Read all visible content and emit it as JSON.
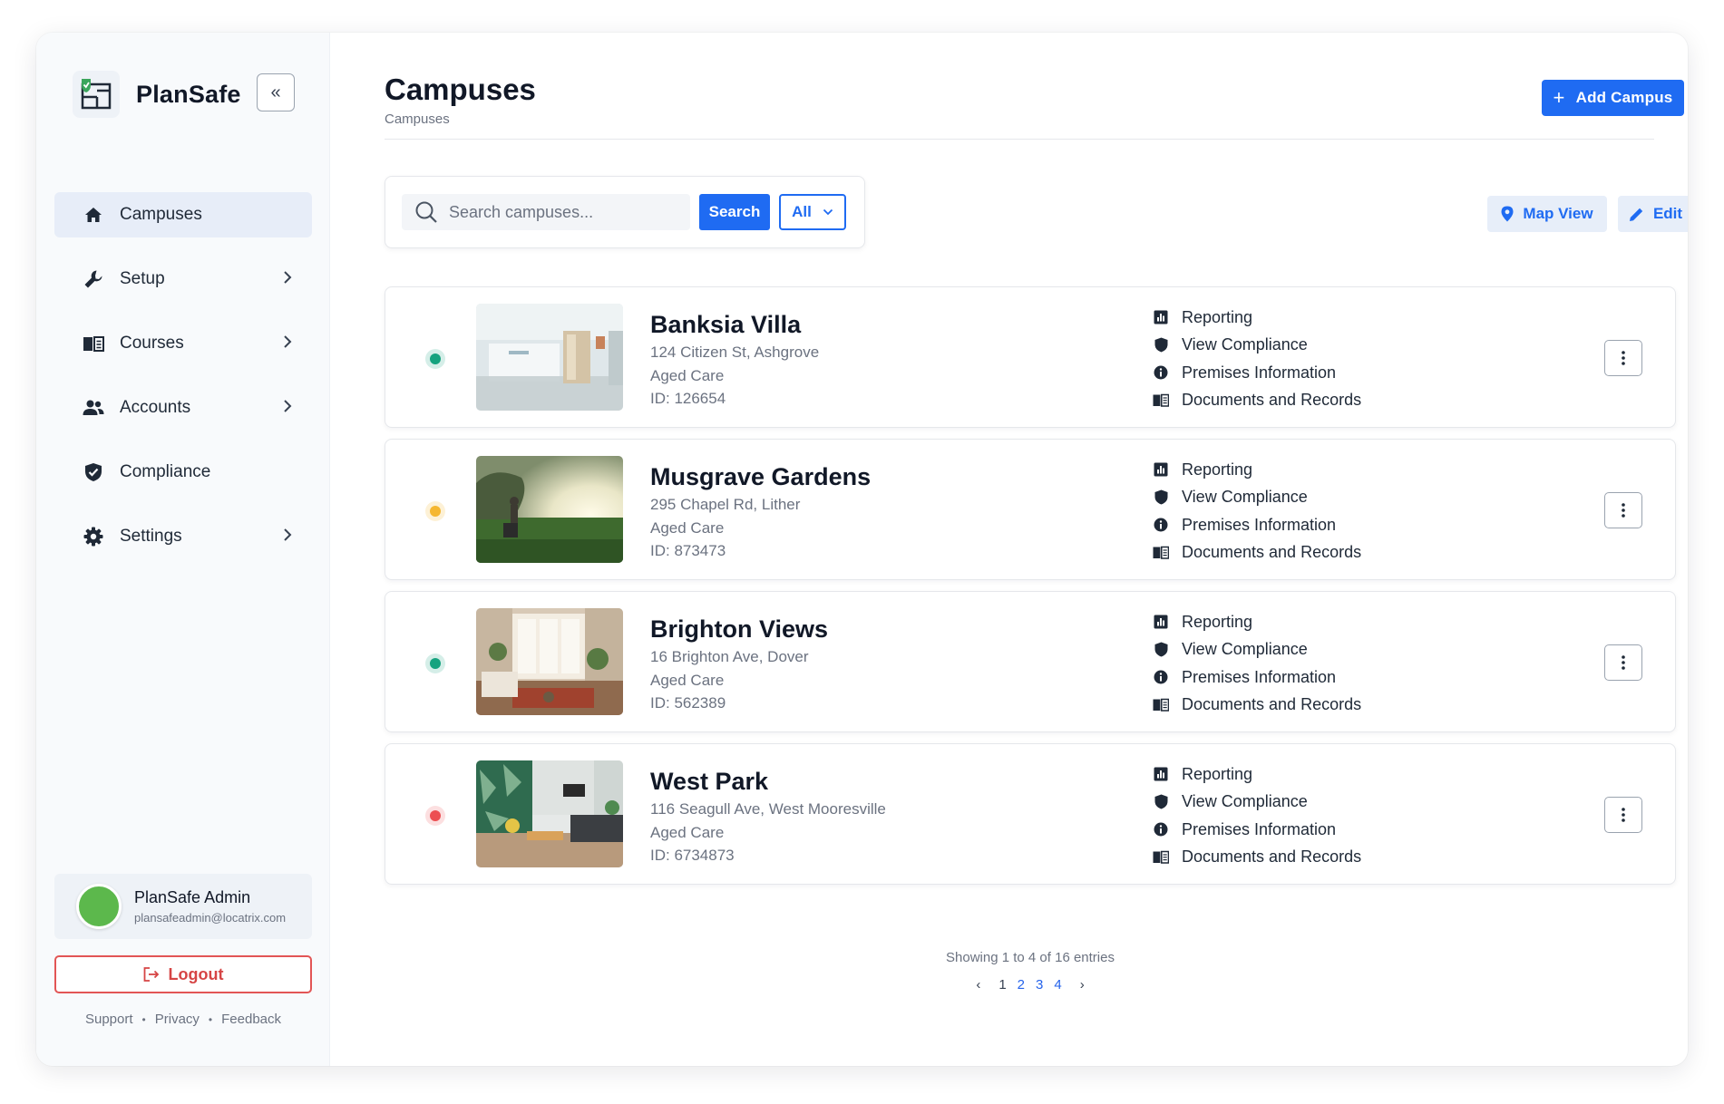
{
  "brand": {
    "name": "PlanSafe",
    "collapse_label": "«"
  },
  "nav": [
    {
      "label": "Campuses",
      "icon": "home-icon",
      "active": true,
      "has_children": false
    },
    {
      "label": "Setup",
      "icon": "wrench-icon",
      "active": false,
      "has_children": true
    },
    {
      "label": "Courses",
      "icon": "book-icon",
      "active": false,
      "has_children": true
    },
    {
      "label": "Accounts",
      "icon": "users-icon",
      "active": false,
      "has_children": true
    },
    {
      "label": "Compliance",
      "icon": "shield-check-icon",
      "active": false,
      "has_children": false
    },
    {
      "label": "Settings",
      "icon": "gear-icon",
      "active": false,
      "has_children": true
    }
  ],
  "user": {
    "name": "PlanSafe Admin",
    "email": "plansafeadmin@locatrix.com",
    "avatar_color": "#5cb84c"
  },
  "logout_label": "Logout",
  "footer_links": [
    "Support",
    "Privacy",
    "Feedback"
  ],
  "header": {
    "title": "Campuses",
    "breadcrumb": "Campuses",
    "add_label": "Add Campus"
  },
  "search": {
    "placeholder": "Search campuses...",
    "button_label": "Search",
    "filter_value": "All"
  },
  "toolbar": {
    "map_view_label": "Map View",
    "edit_label": "Edit"
  },
  "campus_links": [
    {
      "label": "Reporting",
      "icon": "bar-chart-icon"
    },
    {
      "label": "View Compliance",
      "icon": "shield-icon"
    },
    {
      "label": "Premises Information",
      "icon": "info-icon"
    },
    {
      "label": "Documents and Records",
      "icon": "book-icon"
    }
  ],
  "campuses": [
    {
      "name": "Banksia Villa",
      "address": "124 Citizen St, Ashgrove",
      "type": "Aged Care",
      "id": "ID: 126654",
      "status_color": "#16a37f"
    },
    {
      "name": "Musgrave Gardens",
      "address": "295 Chapel Rd, Lither",
      "type": "Aged Care",
      "id": "ID: 873473",
      "status_color": "#f5b731"
    },
    {
      "name": "Brighton Views",
      "address": "16 Brighton Ave, Dover",
      "type": "Aged Care",
      "id": "ID: 562389",
      "status_color": "#16a37f"
    },
    {
      "name": "West Park",
      "address": "116 Seagull Ave, West Mooresville",
      "type": "Aged Care",
      "id": "ID: 6734873",
      "status_color": "#ec4f52"
    }
  ],
  "pagination": {
    "summary": "Showing 1 to 4 of 16 entries",
    "prev": "‹",
    "next": "›",
    "pages": [
      "1",
      "2",
      "3",
      "4"
    ],
    "current": "1"
  },
  "colors": {
    "primary": "#1f6bf2",
    "danger": "#d64545",
    "active_nav_bg": "#e7edf8"
  }
}
